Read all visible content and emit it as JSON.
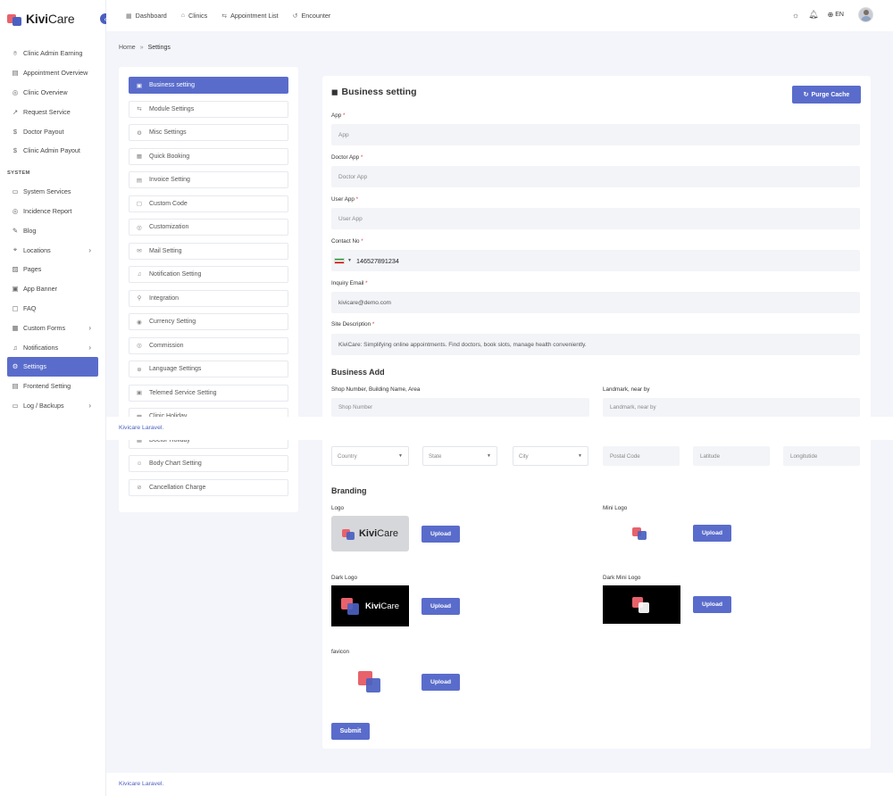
{
  "app": {
    "logo_bold": "Kivi",
    "logo_light": "Care",
    "collapse_icon": "chevron-left-icon"
  },
  "sidebar": {
    "items_top": [
      {
        "label": "Clinic Admin Earning",
        "icon": "earning-icon"
      },
      {
        "label": "Appointment Overview",
        "icon": "overview-icon"
      },
      {
        "label": "Clinic Overview",
        "icon": "location-icon"
      },
      {
        "label": "Request Service",
        "icon": "chart-icon"
      },
      {
        "label": "Doctor Payout",
        "icon": "dollar-icon"
      },
      {
        "label": "Clinic Admin Payout",
        "icon": "dollar-icon"
      }
    ],
    "section_label": "SYSTEM",
    "items_system": [
      {
        "label": "System Services",
        "icon": "monitor-icon"
      },
      {
        "label": "Incidence Report",
        "icon": "location-icon"
      },
      {
        "label": "Blog",
        "icon": "pen-icon"
      },
      {
        "label": "Locations",
        "icon": "map-pin-icon",
        "chevron": true
      },
      {
        "label": "Pages",
        "icon": "page-icon"
      },
      {
        "label": "App Banner",
        "icon": "banner-icon"
      },
      {
        "label": "FAQ",
        "icon": "chat-icon"
      },
      {
        "label": "Custom Forms",
        "icon": "form-icon",
        "chevron": true
      },
      {
        "label": "Notifications",
        "icon": "bell-icon",
        "chevron": true
      },
      {
        "label": "Settings",
        "icon": "gear-icon",
        "active": true
      },
      {
        "label": "Frontend Setting",
        "icon": "frontend-icon"
      },
      {
        "label": "Log / Backups",
        "icon": "log-icon",
        "chevron": true
      }
    ]
  },
  "topbar": {
    "links": [
      {
        "label": "Dashboard",
        "icon": "grid-icon"
      },
      {
        "label": "Clinics",
        "icon": "clinic-icon"
      },
      {
        "label": "Appointment List",
        "icon": "list-icon"
      },
      {
        "label": "Encounter",
        "icon": "history-icon"
      }
    ],
    "lang": "EN",
    "icons": [
      "sun-icon",
      "bell-icon",
      "globe-icon"
    ]
  },
  "breadcrumb": {
    "home": "Home",
    "current": "Settings"
  },
  "settings_menu": [
    {
      "label": "Business setting",
      "active": true
    },
    {
      "label": "Module Settings"
    },
    {
      "label": "Misc Settings"
    },
    {
      "label": "Quick Booking"
    },
    {
      "label": "Invoice Setting"
    },
    {
      "label": "Custom Code"
    },
    {
      "label": "Customization"
    },
    {
      "label": "Mail Setting"
    },
    {
      "label": "Notification Setting"
    },
    {
      "label": "Integration"
    },
    {
      "label": "Currency Setting"
    },
    {
      "label": "Commission"
    },
    {
      "label": "Language Settings"
    },
    {
      "label": "Telemed Service Setting"
    },
    {
      "label": "Clinic Holiday"
    },
    {
      "label": "Doctor Holiday"
    },
    {
      "label": "Body Chart Setting"
    },
    {
      "label": "Cancellation Charge"
    }
  ],
  "form": {
    "title": "Business setting",
    "purge_label": "Purge Cache",
    "fields": {
      "app": {
        "label": "App",
        "placeholder": "App"
      },
      "doctor_app": {
        "label": "Doctor App",
        "placeholder": "Doctor App"
      },
      "user_app": {
        "label": "User App",
        "placeholder": "User App"
      },
      "contact": {
        "label": "Contact No",
        "value": "146527891234"
      },
      "inquiry_email": {
        "label": "Inquiry Email",
        "value": "kivicare@demo.com"
      },
      "site_description": {
        "label": "Site Description",
        "value": "KiviCare: Simplifying online appointments. Find doctors, book slots, manage health conveniently."
      }
    },
    "required_mark": "*",
    "address": {
      "section_title": "Business Add",
      "shop_label": "Shop Number, Building Name, Area",
      "shop_placeholder": "Shop Number",
      "landmark_label": "Landmark, near by",
      "landmark_placeholder": "Landmark, near by",
      "country": "Country",
      "state": "State",
      "city": "City",
      "postal": "Postal Code",
      "latitude": "Latitude",
      "longitude": "Longitutide"
    },
    "branding": {
      "section_title": "Branding",
      "logo": "Logo",
      "mini_logo": "Mini Logo",
      "dark_logo": "Dark Logo",
      "dark_mini_logo": "Dark Mini Logo",
      "favicon": "favicon",
      "upload": "Upload",
      "logo_text_bold": "Kivi",
      "logo_text_light": "Care"
    },
    "submit_label": "Submit"
  },
  "footer": {
    "text": "Kivicare Laravel."
  },
  "colors": {
    "primary": "#5a6ccb",
    "brand_red": "#e8626b",
    "brand_blue": "#4a5fc1"
  }
}
